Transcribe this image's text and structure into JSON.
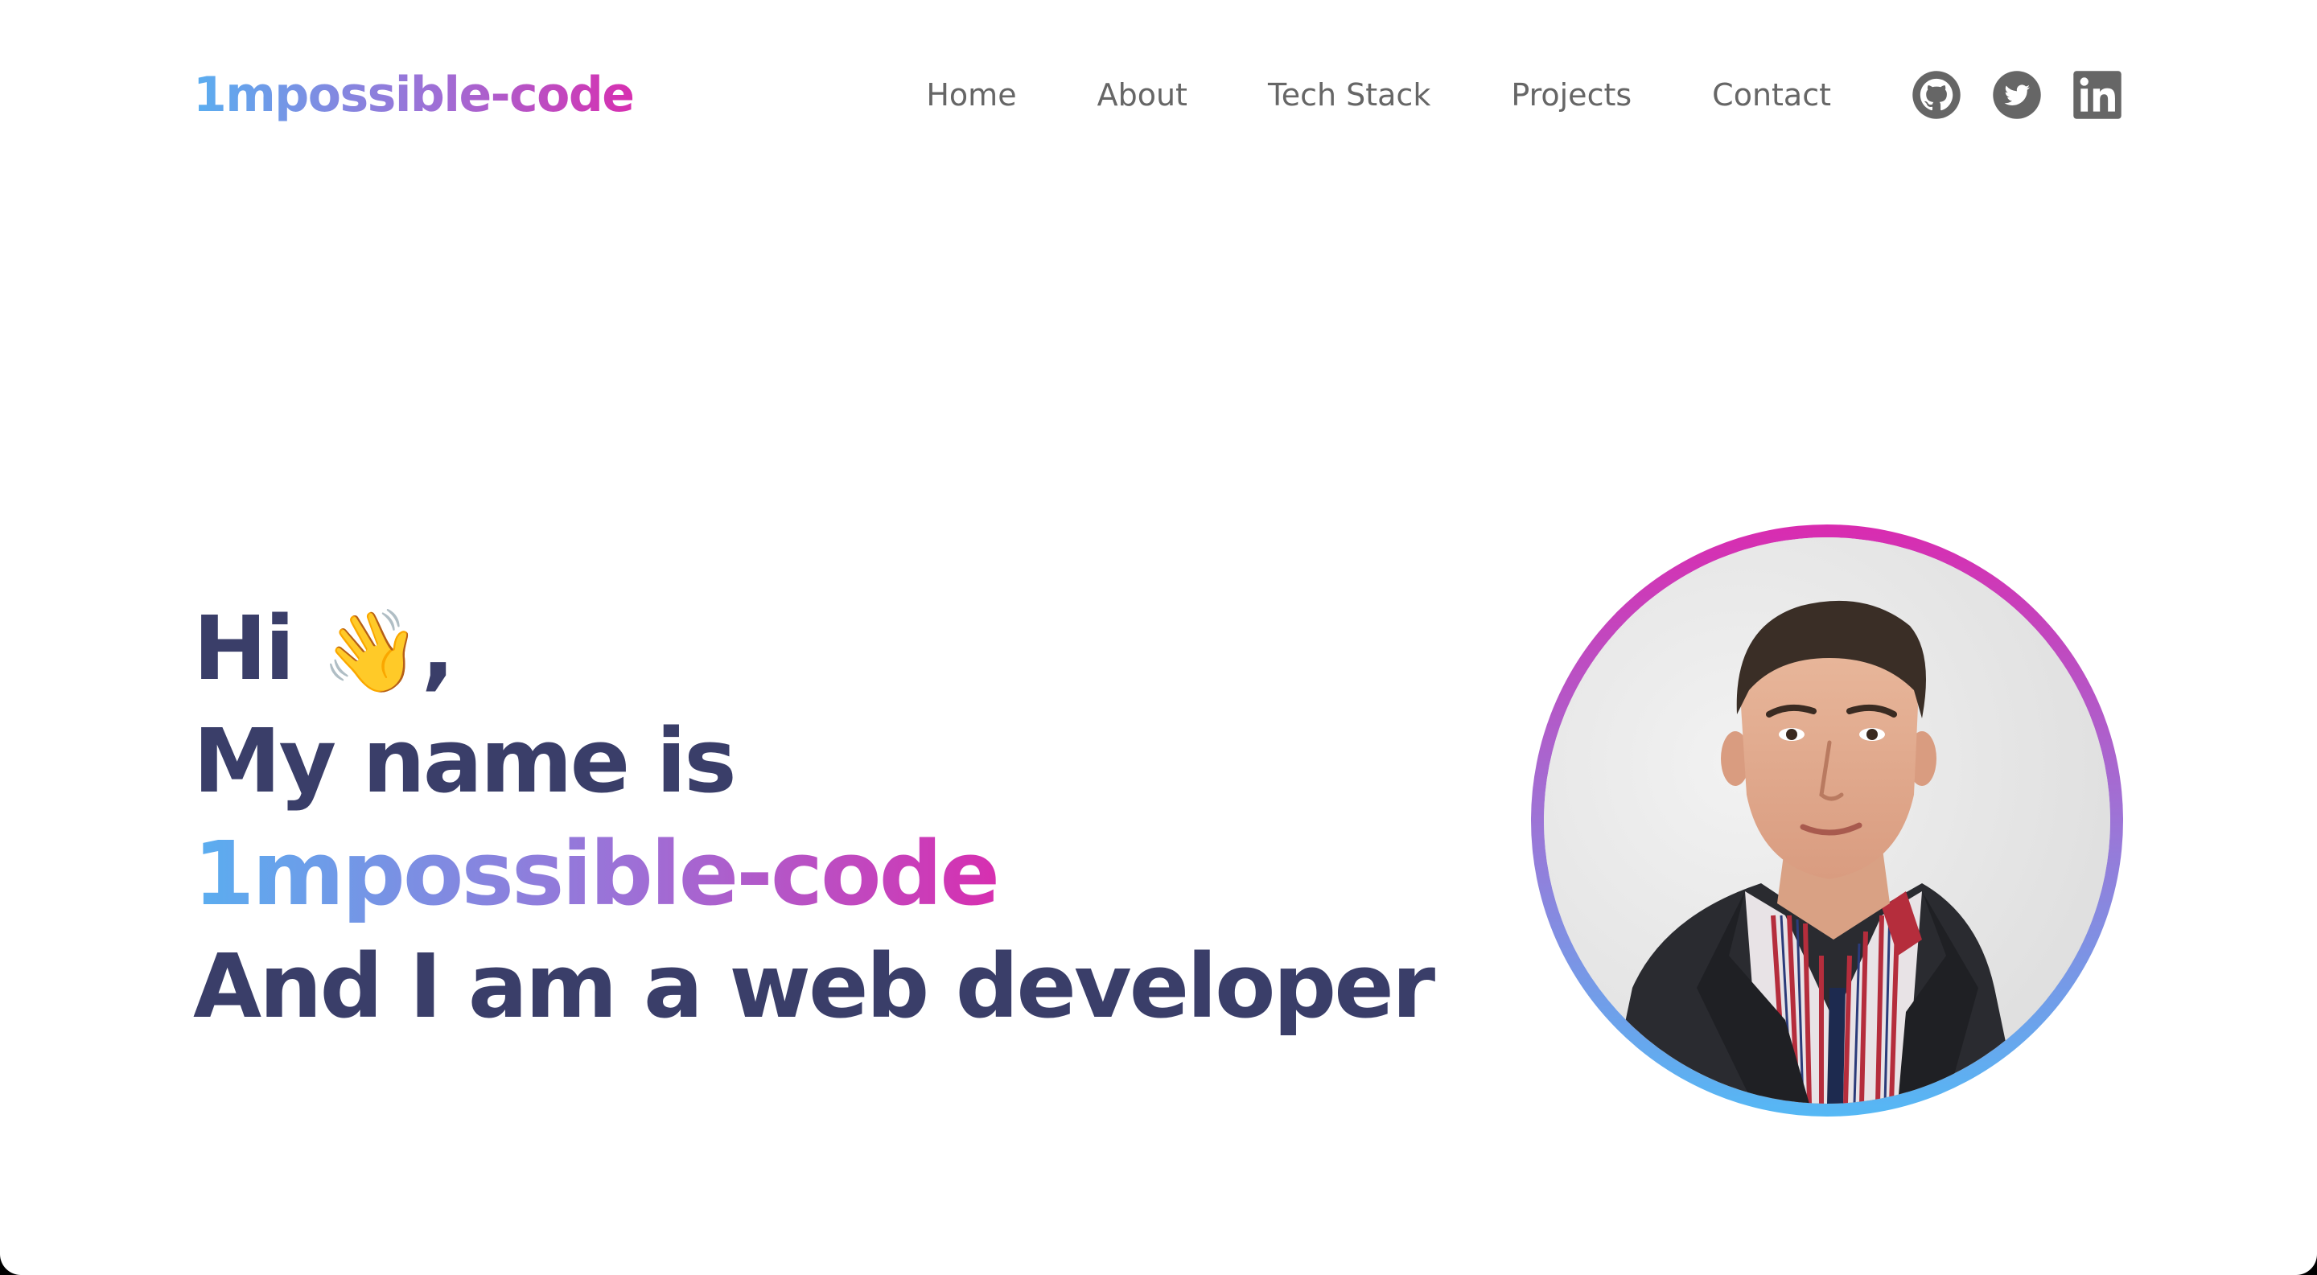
{
  "header": {
    "logo": "1mpossible-code",
    "nav": [
      "Home",
      "About",
      "Tech Stack",
      "Projects",
      "Contact"
    ],
    "social": [
      "github-icon",
      "twitter-icon",
      "linkedin-icon"
    ]
  },
  "hero": {
    "greeting": "Hi",
    "wave_emoji": "👋",
    "greeting_suffix": ",",
    "line2": "My name is",
    "name": "1mpossible-code",
    "line4": "And I am a web developer"
  },
  "colors": {
    "gradient_start": "#5aaef0",
    "gradient_mid": "#9e6fd6",
    "gradient_end": "#d72fb0",
    "heading": "#3a3e69",
    "nav_text": "#666666"
  },
  "avatar": {
    "icon": "profile-photo"
  }
}
